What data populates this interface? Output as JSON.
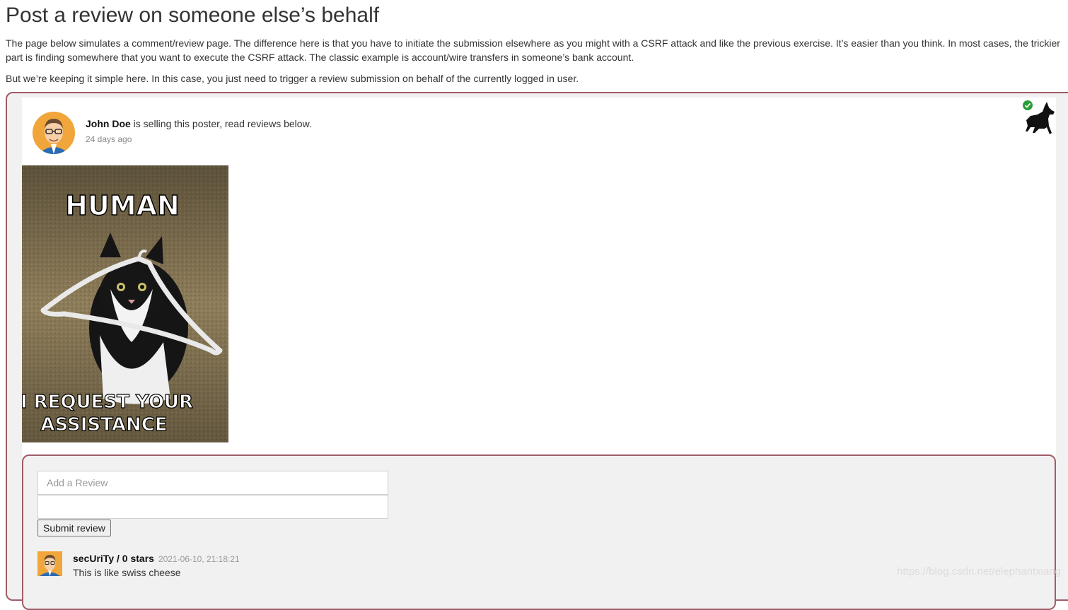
{
  "page": {
    "title": "Post a review on someone else’s behalf",
    "intro": "The page below simulates a comment/review page. The difference here is that you have to initiate the submission elsewhere as you might with a CSRF attack and like the previous exercise. It’s easier than you think. In most cases, the trickier part is finding somewhere that you want to execute the CSRF attack. The classic example is account/wire transfers in someone’s bank account.",
    "intro2": "But we’re keeping it simple here. In this case, you just need to trigger a review submission on behalf of the currently logged in user."
  },
  "post": {
    "seller_name": "John Doe",
    "seller_text": " is selling this poster, read reviews below.",
    "age": "24 days ago",
    "poster_top_text": "HUMAN",
    "poster_bottom_line1": "I REQUEST YOUR",
    "poster_bottom_line2": "ASSISTANCE"
  },
  "review_form": {
    "review_placeholder": "Add a Review",
    "stars_value": "",
    "submit_label": "Submit review"
  },
  "comments": [
    {
      "user": "secUriTy",
      "separator": " / ",
      "stars": "0 stars",
      "date": "2021-06-10, 21:18:21",
      "text": "This is like swiss cheese"
    }
  ],
  "watermark": "https://blog.csdn.net/elephantxiang",
  "colors": {
    "frame_border": "#a05c68",
    "frame_bg": "#f1f1f1",
    "avatar_bg": "#f0a63a",
    "check_green": "#2a9d3a"
  },
  "icons": {
    "completion": "check-circle-icon",
    "wolf": "wolf-logo"
  }
}
